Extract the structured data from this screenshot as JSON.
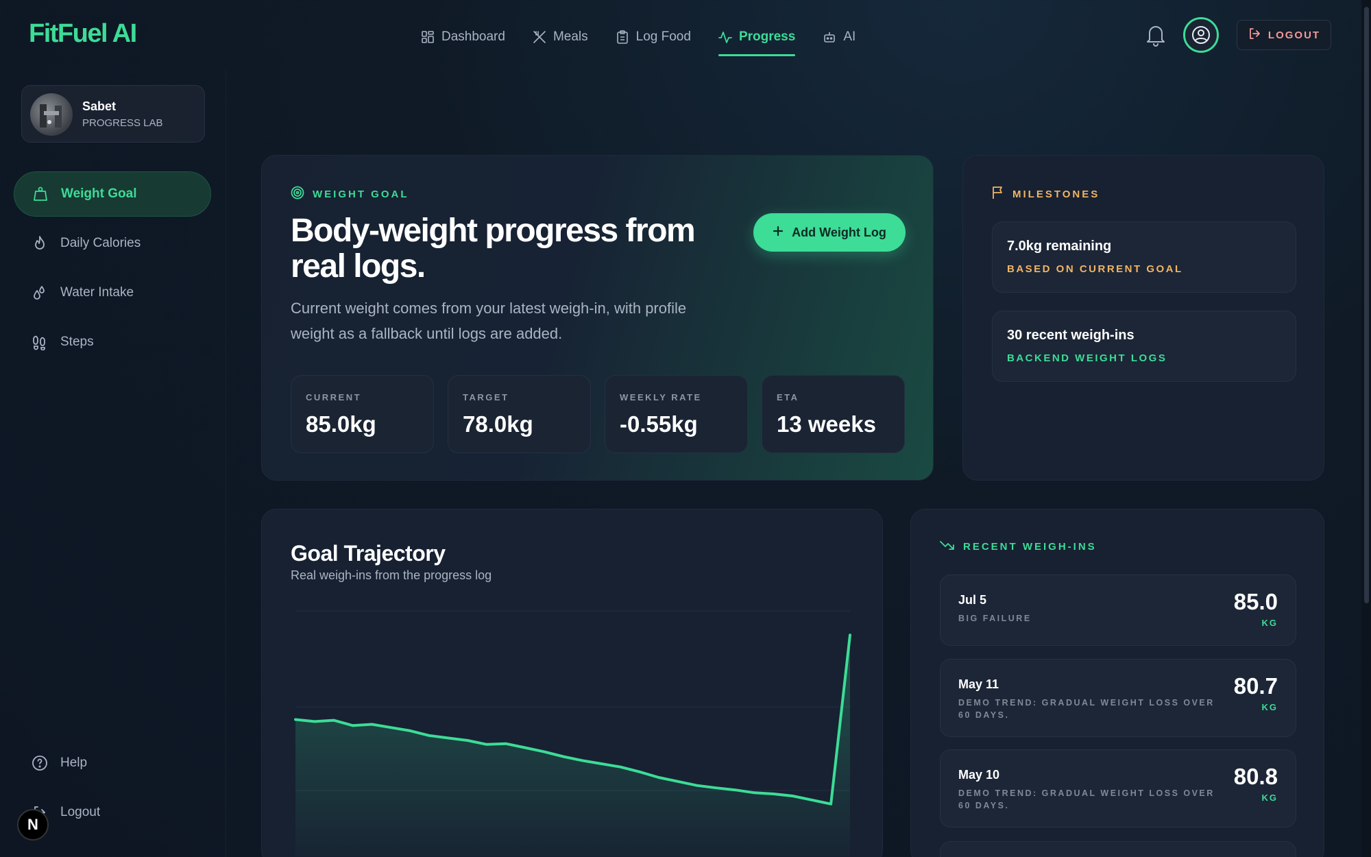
{
  "app": {
    "logo": "FitFuel AI"
  },
  "nav": [
    {
      "label": "Dashboard",
      "icon": "grid-icon"
    },
    {
      "label": "Meals",
      "icon": "utensils-icon"
    },
    {
      "label": "Log Food",
      "icon": "clipboard-icon"
    },
    {
      "label": "Progress",
      "icon": "activity-icon",
      "active": true
    },
    {
      "label": "AI",
      "icon": "bot-icon"
    }
  ],
  "topbar": {
    "logout_label": "LOGOUT"
  },
  "profile": {
    "name": "Sabet",
    "subtitle": "PROGRESS LAB"
  },
  "sidebar": {
    "items": [
      {
        "label": "Weight Goal",
        "icon": "scale-icon",
        "active": true
      },
      {
        "label": "Daily Calories",
        "icon": "flame-icon"
      },
      {
        "label": "Water Intake",
        "icon": "droplets-icon"
      },
      {
        "label": "Steps",
        "icon": "footprints-icon"
      }
    ],
    "help_label": "Help",
    "logout_label": "Logout"
  },
  "badge": {
    "letter": "N"
  },
  "hero": {
    "eyebrow": "WEIGHT GOAL",
    "title": "Body-weight progress from real logs.",
    "description": "Current weight comes from your latest weigh-in, with profile weight as a fallback until logs are added.",
    "add_button": "Add Weight Log",
    "stats": [
      {
        "label": "CURRENT",
        "value": "85.0kg"
      },
      {
        "label": "TARGET",
        "value": "78.0kg"
      },
      {
        "label": "WEEKLY RATE",
        "value": "-0.55kg"
      },
      {
        "label": "ETA",
        "value": "13 weeks"
      }
    ]
  },
  "milestones": {
    "eyebrow": "MILESTONES",
    "items": [
      {
        "title": "7.0kg remaining",
        "subtitle": "BASED ON CURRENT GOAL",
        "color": "#f2b464"
      },
      {
        "title": "30 recent weigh-ins",
        "subtitle": "BACKEND WEIGHT LOGS",
        "color": "#3ddc97"
      }
    ]
  },
  "trajectory": {
    "title": "Goal Trajectory",
    "subtitle": "Real weigh-ins from the progress log"
  },
  "chart_data": {
    "type": "area",
    "title": "Goal Trajectory",
    "subtitle": "Real weigh-ins from the progress log",
    "xlabel": "",
    "ylabel": "",
    "grid": true,
    "legend": "none",
    "ylim": [
      79.5,
      85.6
    ],
    "series": [
      {
        "color": "#3ddc97",
        "values": [
          82.9,
          82.85,
          82.88,
          82.75,
          82.78,
          82.7,
          82.62,
          82.5,
          82.44,
          82.38,
          82.28,
          82.3,
          82.2,
          82.1,
          81.98,
          81.88,
          81.8,
          81.72,
          81.6,
          81.46,
          81.36,
          81.26,
          81.2,
          81.15,
          81.08,
          81.05,
          81.0,
          80.9,
          80.8,
          85.0
        ]
      }
    ]
  },
  "recent": {
    "eyebrow": "RECENT WEIGH-INS",
    "items": [
      {
        "date": "Jul 5",
        "note": "BIG FAILURE",
        "value": "85.0",
        "unit": "KG"
      },
      {
        "date": "May 11",
        "note": "DEMO TREND: GRADUAL WEIGHT LOSS OVER 60 DAYS.",
        "value": "80.7",
        "unit": "KG"
      },
      {
        "date": "May 10",
        "note": "DEMO TREND: GRADUAL WEIGHT LOSS OVER 60 DAYS.",
        "value": "80.8",
        "unit": "KG"
      }
    ]
  }
}
